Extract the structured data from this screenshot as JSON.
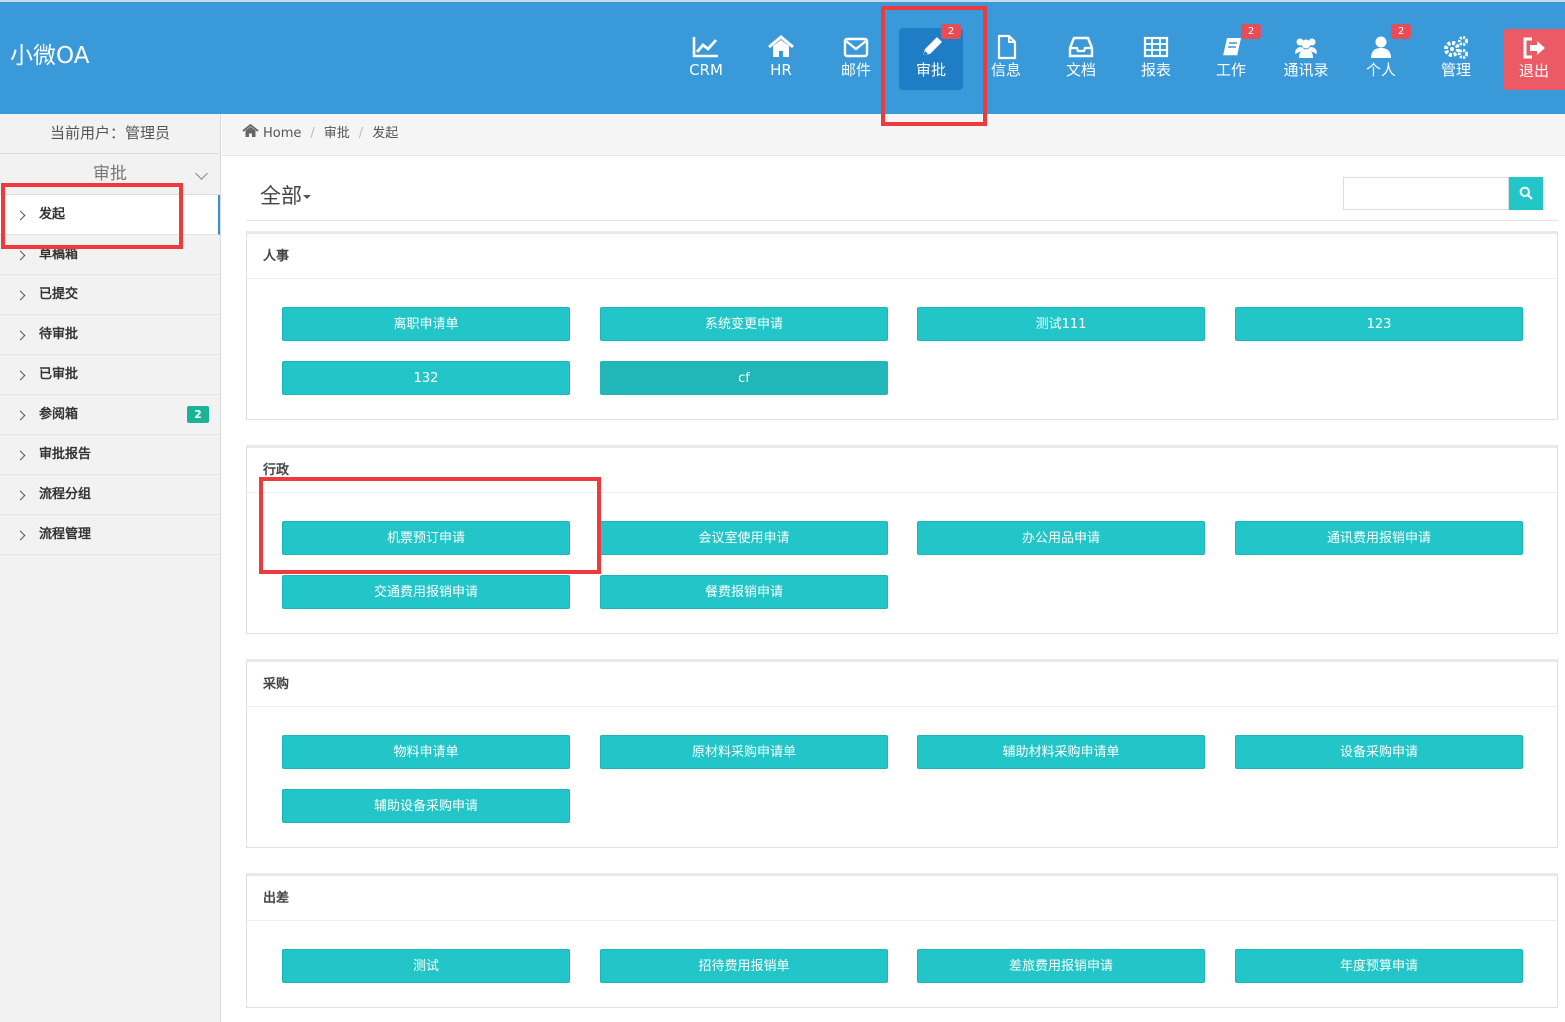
{
  "app": {
    "title": "小微OA"
  },
  "nav": [
    {
      "label": "CRM",
      "icon": "chart-line-icon",
      "badge": ""
    },
    {
      "label": "HR",
      "icon": "home-icon",
      "badge": ""
    },
    {
      "label": "邮件",
      "icon": "envelope-icon",
      "badge": ""
    },
    {
      "label": "审批",
      "icon": "pencil-icon",
      "badge": "2",
      "active": true
    },
    {
      "label": "信息",
      "icon": "file-icon",
      "badge": ""
    },
    {
      "label": "文档",
      "icon": "inbox-icon",
      "badge": ""
    },
    {
      "label": "报表",
      "icon": "table-icon",
      "badge": ""
    },
    {
      "label": "工作",
      "icon": "book-icon",
      "badge": "2"
    },
    {
      "label": "通讯录",
      "icon": "users-icon",
      "badge": ""
    },
    {
      "label": "个人",
      "icon": "user-icon",
      "badge": "2"
    },
    {
      "label": "管理",
      "icon": "gears-icon",
      "badge": ""
    }
  ],
  "logout": {
    "label": "退出",
    "icon": "sign-out-icon"
  },
  "sidebar": {
    "current_user": "当前用户：管理员",
    "section": "审批",
    "items": [
      {
        "label": "发起",
        "active": true,
        "badge": ""
      },
      {
        "label": "草稿箱",
        "badge": ""
      },
      {
        "label": "已提交",
        "badge": ""
      },
      {
        "label": "待审批",
        "badge": ""
      },
      {
        "label": "已审批",
        "badge": ""
      },
      {
        "label": "参阅箱",
        "badge": "2"
      },
      {
        "label": "审批报告",
        "badge": ""
      },
      {
        "label": "流程分组",
        "badge": ""
      },
      {
        "label": "流程管理",
        "badge": ""
      }
    ]
  },
  "breadcrumb": {
    "home": "Home",
    "level1": "审批",
    "level2": "发起"
  },
  "main": {
    "filter_label": "全部",
    "search": {
      "placeholder": "",
      "value": ""
    },
    "groups": [
      {
        "title": "人事",
        "buttons": [
          "离职申请单",
          "系统变更申请",
          "测试111",
          "123",
          "132",
          "cf"
        ]
      },
      {
        "title": "行政",
        "buttons": [
          "机票预订申请",
          "会议室使用申请",
          "办公用品申请",
          "通讯费用报销申请",
          "交通费用报销申请",
          "餐费报销申请"
        ]
      },
      {
        "title": "采购",
        "buttons": [
          "物料申请单",
          "原材料采购申请单",
          "辅助材料采购申请单",
          "设备采购申请",
          "辅助设备采购申请"
        ]
      },
      {
        "title": "出差",
        "buttons": [
          "测试",
          "招待费用报销单",
          "差旅费用报销申请",
          "年度预算申请"
        ]
      }
    ]
  },
  "colors": {
    "header": "#3a99d9",
    "accent": "#23c6c8",
    "badge": "#e84d57",
    "logout": "#ec5b65",
    "highlight": "#ee3a3c"
  }
}
